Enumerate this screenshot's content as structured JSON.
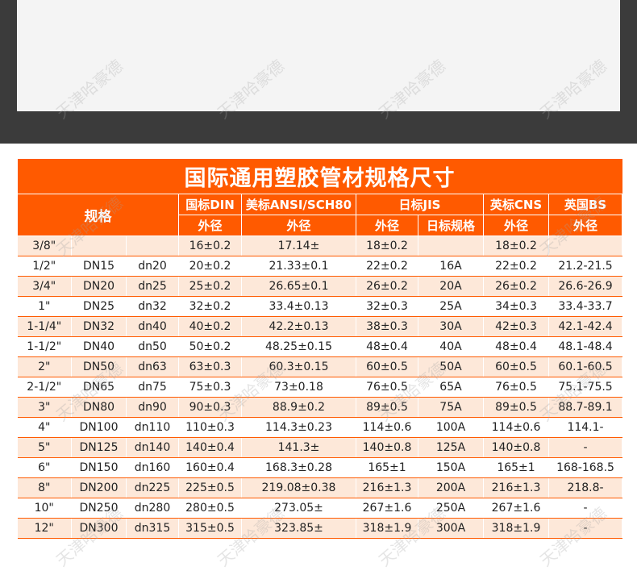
{
  "title": "国际通用塑胶管材规格尺寸",
  "watermark": "天津哈豪德",
  "colors": {
    "accent": "#ff5a00",
    "stripe": "#fde8d9",
    "dark_band": "#3b3b3b"
  },
  "headers": {
    "spec": "规格",
    "din": "国标DIN",
    "ansi": "美标ANSI/SCH80",
    "jis": "日标JIS",
    "cns": "英标CNS",
    "bs": "英国BS",
    "od": "外径",
    "jis_spec": "日标规格"
  },
  "rows": [
    [
      "3/8\"",
      "",
      "",
      "16±0.2",
      "17.14±",
      "18±0.2",
      "",
      "18±0.2",
      ""
    ],
    [
      "1/2\"",
      "DN15",
      "dn20",
      "20±0.2",
      "21.33±0.1",
      "22±0.2",
      "16A",
      "22±0.2",
      "21.2-21.5"
    ],
    [
      "3/4\"",
      "DN20",
      "dn25",
      "25±0.2",
      "26.65±0.1",
      "26±0.2",
      "20A",
      "26±0.2",
      "26.6-26.9"
    ],
    [
      "1\"",
      "DN25",
      "dn32",
      "32±0.2",
      "33.4±0.13",
      "32±0.3",
      "25A",
      "34±0.3",
      "33.4-33.7"
    ],
    [
      "1-1/4\"",
      "DN32",
      "dn40",
      "40±0.2",
      "42.2±0.13",
      "38±0.3",
      "30A",
      "42±0.3",
      "42.1-42.4"
    ],
    [
      "1-1/2\"",
      "DN40",
      "dn50",
      "50±0.2",
      "48.25±0.15",
      "48±0.4",
      "40A",
      "48±0.4",
      "48.1-48.4"
    ],
    [
      "2\"",
      "DN50",
      "dn63",
      "63±0.3",
      "60.3±0.15",
      "60±0.5",
      "50A",
      "60±0.5",
      "60.1-60.5"
    ],
    [
      "2-1/2\"",
      "DN65",
      "dn75",
      "75±0.3",
      "73±0.18",
      "76±0.5",
      "65A",
      "76±0.5",
      "75.1-75.5"
    ],
    [
      "3\"",
      "DN80",
      "dn90",
      "90±0.3",
      "88.9±0.2",
      "89±0.5",
      "75A",
      "89±0.5",
      "88.7-89.1"
    ],
    [
      "4\"",
      "DN100",
      "dn110",
      "110±0.3",
      "114.3±0.23",
      "114±0.6",
      "100A",
      "114±0.6",
      "114.1-"
    ],
    [
      "5\"",
      "DN125",
      "dn140",
      "140±0.4",
      "141.3±",
      "140±0.8",
      "125A",
      "140±0.8",
      "-"
    ],
    [
      "6\"",
      "DN150",
      "dn160",
      "160±0.4",
      "168.3±0.28",
      "165±1",
      "150A",
      "165±1",
      "168-168.5"
    ],
    [
      "8\"",
      "DN200",
      "dn225",
      "225±0.5",
      "219.08±0.38",
      "216±1.3",
      "200A",
      "216±1.3",
      "218.8-"
    ],
    [
      "10\"",
      "DN250",
      "dn280",
      "280±0.5",
      "273.05±",
      "267±1.6",
      "250A",
      "267±1.6",
      "-"
    ],
    [
      "12\"",
      "DN300",
      "dn315",
      "315±0.5",
      "323.85±",
      "318±1.9",
      "300A",
      "318±1.9",
      "-"
    ]
  ]
}
